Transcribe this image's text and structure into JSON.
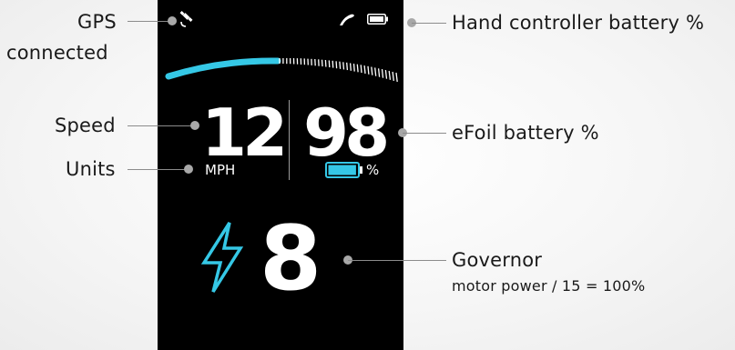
{
  "annotations": {
    "gps_line1": "GPS",
    "gps_line2": "connected",
    "speed": "Speed",
    "units": "Units",
    "hand_battery": "Hand controller battery %",
    "efoil_battery": "eFoil battery %",
    "governor_title": "Governor",
    "governor_sub": "motor power / 15 = 100%"
  },
  "display": {
    "speed_value": "12",
    "speed_unit": "MPH",
    "battery_value": "98",
    "battery_unit": "%",
    "governor_value": "8",
    "battery_level": 0.98,
    "speed_arc_fraction": 0.45
  },
  "icons": {
    "gps": "satellite-icon",
    "hand_controller": "hand-controller-icon",
    "hand_battery": "battery-icon",
    "efoil_battery": "efoil-battery-icon",
    "governor": "lightning-bolt-icon"
  },
  "colors": {
    "accent": "#35c8e6",
    "screen": "#000000"
  }
}
